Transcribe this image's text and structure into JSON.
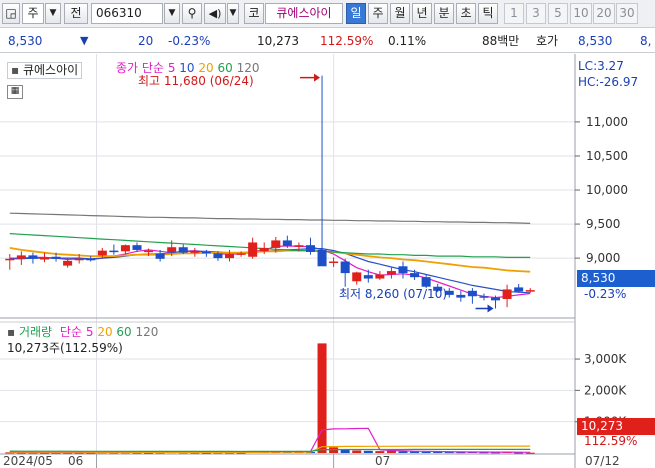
{
  "toolbar": {
    "market": "주",
    "search_label": "전",
    "code": "066310",
    "chart_type": "코",
    "stock_name": "큐에스아이",
    "periods": [
      "일",
      "주",
      "월",
      "년",
      "분",
      "초",
      "틱"
    ],
    "active_period": "일",
    "intervals": [
      "1",
      "3",
      "5",
      "10",
      "20",
      "30"
    ]
  },
  "quote": {
    "price": "8,530",
    "change": "20",
    "change_rate": "-0.23%",
    "volume": "10,273",
    "volume_ratio": "112.59%",
    "turnover": "0.11%",
    "amount": "88백만",
    "ask_label": "호가",
    "ask_price": "8,530",
    "ask_price_2": "8,"
  },
  "price_panel": {
    "name": "큐에스아이",
    "indicator": "종가 단순",
    "ma_periods": [
      "5",
      "10",
      "20",
      "60",
      "120"
    ],
    "high_label": "최고 11,680 (06/24)",
    "low_label": "최저 8,260 (07/10)",
    "lc": "LC:3.27",
    "hc": "HC:-26.97",
    "current_price": "8,530",
    "current_change": "-0.23%"
  },
  "volume_panel": {
    "name": "거래량",
    "indicator": "단순",
    "ma_periods": [
      "5",
      "20",
      "60",
      "120"
    ],
    "current_volume": "10,273주(112.59%)",
    "current_value": "10,273",
    "current_ratio": "112.59%"
  },
  "x_axis": {
    "labels": [
      "2024/05",
      "06",
      "07",
      "07/12"
    ]
  },
  "chart_data": [
    {
      "type": "candlestick",
      "y_ticks": [
        "11,000",
        "10,500",
        "10,000",
        "9,500",
        "9,000"
      ],
      "y_tick_values": [
        11000,
        10500,
        10000,
        9500,
        9000
      ],
      "ylim": [
        8150,
        11880
      ],
      "candles": [
        {
          "o": 8990,
          "h": 9060,
          "l": 8830,
          "c": 8990
        },
        {
          "o": 8990,
          "h": 9100,
          "l": 8900,
          "c": 9040
        },
        {
          "o": 9040,
          "h": 9080,
          "l": 8920,
          "c": 8990
        },
        {
          "o": 8980,
          "h": 9080,
          "l": 8940,
          "c": 9010
        },
        {
          "o": 9020,
          "h": 9080,
          "l": 8950,
          "c": 8990
        },
        {
          "o": 8890,
          "h": 9000,
          "l": 8860,
          "c": 8960
        },
        {
          "o": 8990,
          "h": 9060,
          "l": 8920,
          "c": 8990
        },
        {
          "o": 8990,
          "h": 9030,
          "l": 8950,
          "c": 8980
        },
        {
          "o": 9040,
          "h": 9150,
          "l": 9000,
          "c": 9110
        },
        {
          "o": 9110,
          "h": 9200,
          "l": 9050,
          "c": 9090
        },
        {
          "o": 9100,
          "h": 9200,
          "l": 9060,
          "c": 9190
        },
        {
          "o": 9190,
          "h": 9230,
          "l": 9090,
          "c": 9120
        },
        {
          "o": 9110,
          "h": 9140,
          "l": 9030,
          "c": 9110
        },
        {
          "o": 9070,
          "h": 9120,
          "l": 8950,
          "c": 8990
        },
        {
          "o": 9090,
          "h": 9260,
          "l": 9030,
          "c": 9160
        },
        {
          "o": 9160,
          "h": 9200,
          "l": 9060,
          "c": 9080
        },
        {
          "o": 9080,
          "h": 9150,
          "l": 9020,
          "c": 9100
        },
        {
          "o": 9090,
          "h": 9120,
          "l": 9020,
          "c": 9070
        },
        {
          "o": 9070,
          "h": 9100,
          "l": 8960,
          "c": 9000
        },
        {
          "o": 9000,
          "h": 9120,
          "l": 8950,
          "c": 9060
        },
        {
          "o": 9060,
          "h": 9100,
          "l": 9020,
          "c": 9070
        },
        {
          "o": 9020,
          "h": 9300,
          "l": 8990,
          "c": 9230
        },
        {
          "o": 9100,
          "h": 9230,
          "l": 9060,
          "c": 9150
        },
        {
          "o": 9150,
          "h": 9310,
          "l": 9080,
          "c": 9260
        },
        {
          "o": 9260,
          "h": 9330,
          "l": 9150,
          "c": 9180
        },
        {
          "o": 9180,
          "h": 9230,
          "l": 9100,
          "c": 9190
        },
        {
          "o": 9190,
          "h": 9300,
          "l": 9050,
          "c": 9090
        },
        {
          "o": 9120,
          "h": 11680,
          "l": 9110,
          "c": 8880
        },
        {
          "o": 8930,
          "h": 9010,
          "l": 8870,
          "c": 8950
        },
        {
          "o": 8950,
          "h": 8990,
          "l": 8580,
          "c": 8780
        },
        {
          "o": 8660,
          "h": 8800,
          "l": 8610,
          "c": 8790
        },
        {
          "o": 8750,
          "h": 8830,
          "l": 8640,
          "c": 8700
        },
        {
          "o": 8700,
          "h": 8810,
          "l": 8680,
          "c": 8760
        },
        {
          "o": 8760,
          "h": 8860,
          "l": 8700,
          "c": 8810
        },
        {
          "o": 8880,
          "h": 8950,
          "l": 8700,
          "c": 8780
        },
        {
          "o": 8780,
          "h": 8830,
          "l": 8680,
          "c": 8720
        },
        {
          "o": 8720,
          "h": 8760,
          "l": 8560,
          "c": 8580
        },
        {
          "o": 8580,
          "h": 8620,
          "l": 8500,
          "c": 8520
        },
        {
          "o": 8520,
          "h": 8560,
          "l": 8420,
          "c": 8460
        },
        {
          "o": 8460,
          "h": 8520,
          "l": 8360,
          "c": 8420
        },
        {
          "o": 8520,
          "h": 8560,
          "l": 8330,
          "c": 8440
        },
        {
          "o": 8440,
          "h": 8480,
          "l": 8380,
          "c": 8420
        },
        {
          "o": 8420,
          "h": 8450,
          "l": 8260,
          "c": 8380
        },
        {
          "o": 8400,
          "h": 8610,
          "l": 8280,
          "c": 8540
        },
        {
          "o": 8570,
          "h": 8620,
          "l": 8490,
          "c": 8510
        },
        {
          "o": 8510,
          "h": 8560,
          "l": 8490,
          "c": 8530
        }
      ],
      "series": [
        {
          "color": "#e020c8",
          "values": [
            9000,
            9000,
            9010,
            9010,
            9000,
            8980,
            8990,
            8980,
            9000,
            9030,
            9060,
            9100,
            9120,
            9100,
            9080,
            9100,
            9110,
            9090,
            9060,
            9060,
            9060,
            9100,
            9120,
            9170,
            9180,
            9170,
            9170,
            9120,
            9060,
            8960,
            8860,
            8800,
            8750,
            8760,
            8770,
            8750,
            8710,
            8650,
            8590,
            8530,
            8470,
            8440,
            8420,
            8440,
            8460,
            8480
          ]
        },
        {
          "color": "#2a4fc8",
          "values": [
            8990,
            8990,
            9000,
            9000,
            9000,
            9000,
            9000,
            8990,
            9000,
            9010,
            9030,
            9050,
            9060,
            9060,
            9080,
            9100,
            9100,
            9100,
            9090,
            9080,
            9070,
            9080,
            9100,
            9110,
            9120,
            9130,
            9140,
            9140,
            9110,
            9070,
            9010,
            8950,
            8910,
            8870,
            8830,
            8800,
            8760,
            8720,
            8680,
            8640,
            8600,
            8570,
            8540,
            8510,
            8500,
            8490
          ]
        },
        {
          "color": "#f0a000",
          "values": [
            9150,
            9120,
            9100,
            9080,
            9060,
            9050,
            9040,
            9030,
            9030,
            9030,
            9040,
            9050,
            9050,
            9050,
            9060,
            9070,
            9070,
            9080,
            9080,
            9080,
            9080,
            9090,
            9100,
            9100,
            9110,
            9110,
            9110,
            9100,
            9090,
            9070,
            9050,
            9030,
            9010,
            9000,
            8980,
            8970,
            8950,
            8930,
            8910,
            8890,
            8870,
            8860,
            8840,
            8820,
            8810,
            8800
          ]
        },
        {
          "color": "#22a050",
          "values": [
            9360,
            9350,
            9340,
            9330,
            9320,
            9310,
            9300,
            9290,
            9280,
            9270,
            9260,
            9250,
            9240,
            9230,
            9220,
            9210,
            9200,
            9190,
            9180,
            9170,
            9160,
            9150,
            9140,
            9130,
            9120,
            9110,
            9110,
            9100,
            9090,
            9080,
            9070,
            9060,
            9060,
            9050,
            9050,
            9040,
            9040,
            9030,
            9030,
            9030,
            9020,
            9020,
            9020,
            9010,
            9010,
            9010
          ]
        },
        {
          "color": "#777777",
          "values": [
            9660,
            9655,
            9650,
            9645,
            9640,
            9635,
            9630,
            9625,
            9620,
            9615,
            9610,
            9605,
            9600,
            9600,
            9595,
            9590,
            9590,
            9585,
            9580,
            9580,
            9575,
            9575,
            9570,
            9570,
            9565,
            9565,
            9560,
            9560,
            9555,
            9555,
            9550,
            9550,
            9545,
            9545,
            9540,
            9540,
            9535,
            9535,
            9530,
            9530,
            9525,
            9525,
            9520,
            9520,
            9515,
            9510
          ]
        }
      ]
    },
    {
      "type": "bar",
      "y_ticks": [
        "3,000K",
        "2,000K",
        "1,000K"
      ],
      "y_tick_values": [
        3000,
        2000,
        1000
      ],
      "ylim": [
        0,
        3800
      ],
      "values": [
        20,
        15,
        18,
        12,
        16,
        14,
        15,
        12,
        25,
        20,
        22,
        18,
        14,
        20,
        28,
        22,
        18,
        15,
        20,
        18,
        16,
        60,
        40,
        55,
        45,
        35,
        30,
        3500,
        180,
        120,
        80,
        70,
        60,
        70,
        50,
        45,
        40,
        35,
        30,
        28,
        35,
        25,
        22,
        40,
        15,
        10
      ],
      "up": [
        true,
        true,
        false,
        true,
        false,
        true,
        false,
        false,
        true,
        false,
        true,
        false,
        false,
        false,
        true,
        false,
        true,
        false,
        false,
        true,
        true,
        true,
        true,
        true,
        false,
        true,
        false,
        true,
        true,
        false,
        true,
        false,
        true,
        true,
        false,
        false,
        false,
        false,
        false,
        false,
        false,
        false,
        false,
        true,
        false,
        true
      ],
      "series": [
        {
          "color": "#e020c8",
          "values": [
            18,
            17,
            16,
            17,
            16,
            15,
            15,
            14,
            16,
            18,
            20,
            21,
            20,
            19,
            20,
            20,
            20,
            18,
            18,
            18,
            18,
            26,
            31,
            38,
            43,
            47,
            41,
            733,
            768,
            774,
            782,
            790,
            102,
            80,
            66,
            59,
            53,
            48,
            42,
            36,
            32,
            31,
            28,
            30,
            27,
            22
          ]
        },
        {
          "color": "#f0a000",
          "values": [
            30,
            29,
            28,
            27,
            26,
            25,
            24,
            23,
            22,
            22,
            21,
            20,
            20,
            19,
            19,
            18,
            18,
            18,
            18,
            18,
            18,
            20,
            22,
            24,
            25,
            27,
            28,
            200,
            205,
            210,
            212,
            213,
            214,
            215,
            216,
            217,
            217,
            218,
            218,
            218,
            219,
            219,
            219,
            220,
            220,
            220
          ]
        },
        {
          "color": "#22a050",
          "values": [
            60,
            59,
            58,
            58,
            57,
            56,
            55,
            55,
            54,
            54,
            53,
            53,
            52,
            52,
            51,
            51,
            51,
            50,
            50,
            50,
            49,
            50,
            50,
            51,
            51,
            52,
            52,
            108,
            110,
            111,
            112,
            112,
            113,
            113,
            113,
            114,
            114,
            114,
            115,
            115,
            115,
            115,
            115,
            116,
            116,
            116
          ]
        }
      ]
    }
  ],
  "colors": {
    "up": "#e0201a",
    "down": "#1e4fc8",
    "current_box": "#1e5fd0",
    "current_vol_box": "#e0201a",
    "grid": "#dfe2e7"
  }
}
